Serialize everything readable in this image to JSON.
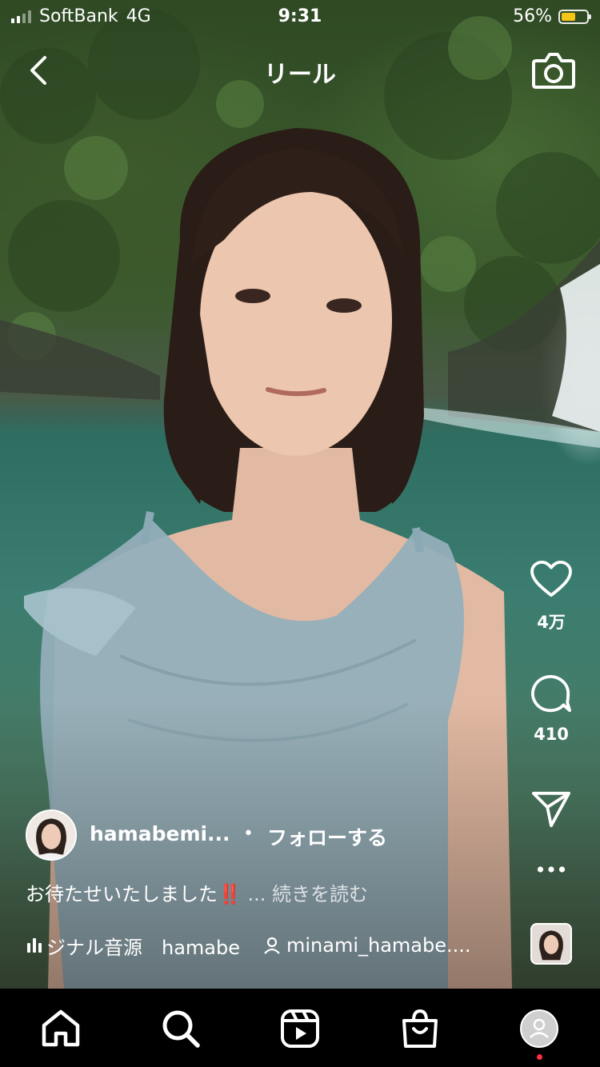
{
  "status_bar": {
    "carrier": "SoftBank",
    "network": "4G",
    "time": "9:31",
    "battery_percent": "56%",
    "battery_level": 0.56,
    "battery_color": "#f5c518"
  },
  "header": {
    "title": "リール",
    "back_icon": "chevron-left-icon",
    "camera_icon": "camera-icon"
  },
  "actions": {
    "like": {
      "icon": "heart-icon",
      "count": "4万"
    },
    "comment": {
      "icon": "comment-icon",
      "count": "410"
    },
    "share": {
      "icon": "send-icon"
    },
    "more": {
      "icon": "more-dots-icon"
    }
  },
  "post": {
    "username": "hamabemi...",
    "separator": "•",
    "follow_label": "フォローする",
    "caption": "お待たせいたしました",
    "caption_emoji": "‼️",
    "caption_more": "... 続きを読む",
    "audio_text": "ジナル音源　hamabe",
    "tagged_user": "minami_hamabe...."
  },
  "tabbar": {
    "items": [
      "home-icon",
      "search-icon",
      "reels-icon",
      "shop-icon",
      "profile-avatar"
    ],
    "notification_color": "#ff3040"
  }
}
